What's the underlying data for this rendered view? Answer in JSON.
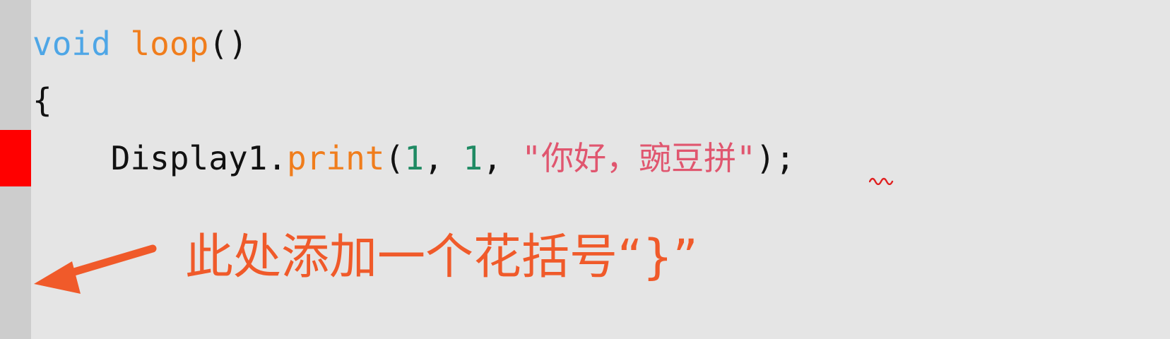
{
  "colors": {
    "background": "#e5e5e5",
    "gutter": "#cdcdcd",
    "error_marker": "#ff0000",
    "keyword": "#4ea6e6",
    "function": "#f07d1c",
    "number": "#1f8a63",
    "string": "#e0566f",
    "plain": "#111111",
    "annotation": "#f05a2a"
  },
  "code": {
    "line1": {
      "keyword": "void",
      "space": " ",
      "function_name": "loop",
      "parens": "()"
    },
    "line2": {
      "brace": "{"
    },
    "line3": {
      "indent": "    ",
      "object": "Display1.",
      "method": "print",
      "open_paren": "(",
      "arg1": "1",
      "sep1": ", ",
      "arg2": "1",
      "sep2": ", ",
      "string_literal": "\"你好，豌豆拼\"",
      "close": ")",
      "semicolon": ";"
    }
  },
  "annotation": {
    "text": "此处添加一个花括号“}”",
    "arrow_icon": "arrow-left-down-icon"
  },
  "error": {
    "marker_icon": "error-line-marker",
    "squiggle_icon": "error-squiggle-icon"
  }
}
